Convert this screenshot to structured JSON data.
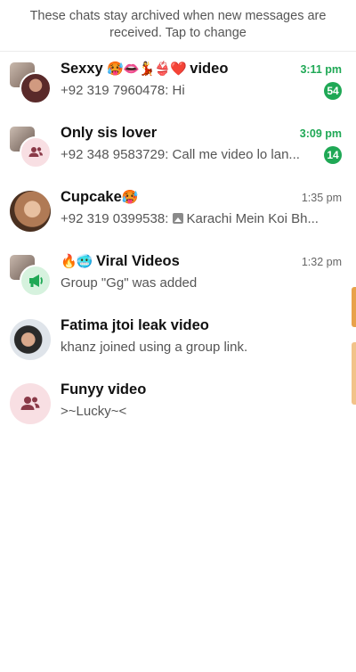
{
  "banner": {
    "text": "These chats stay archived when new messages are received. Tap to change"
  },
  "chats": [
    {
      "name": "Sexxy",
      "emoji": "🥵👄💃👙❤️",
      "name_suffix": "video",
      "time": "3:11 pm",
      "preview": "+92 319 7960478: Hi",
      "unread": "54"
    },
    {
      "name": "Only sis lover",
      "time": "3:09 pm",
      "preview": "+92 348 9583729: Call me video lo lan...",
      "unread": "14"
    },
    {
      "name": "Cupcake",
      "emoji": "🥵",
      "time": "1:35 pm",
      "preview_prefix": "+92 319 0399538:",
      "preview": "Karachi Mein Koi Bh..."
    },
    {
      "name_prefix_emoji": "🔥🥶",
      "name": "Viral Videos",
      "time": "1:32 pm",
      "preview": "Group \"Gg\" was added"
    },
    {
      "name": "Fatima jtoi leak video",
      "preview": "khanz joined using a group link."
    },
    {
      "name": "Funyy video",
      "preview": ">~Lucky~<"
    }
  ],
  "colors": {
    "accent_green": "#1fa855",
    "group_icon_pink": "#f8dfe3",
    "group_icon_glyph": "#8a3a48",
    "community_icon_bg": "#d6f2de"
  },
  "icons": {
    "group": "group-icon",
    "community": "megaphone-icon",
    "image": "image-icon"
  }
}
